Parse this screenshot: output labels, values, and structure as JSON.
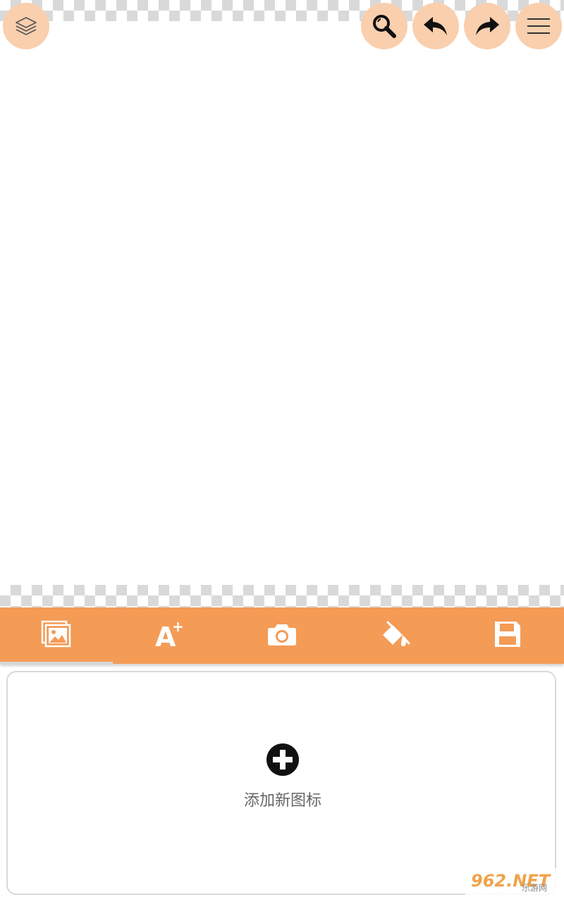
{
  "app": {
    "accent_color": "#f49b56",
    "fab_color": "#f9cfae"
  },
  "top_actions": [
    {
      "name": "layers",
      "icon": "layers-icon"
    },
    {
      "name": "zoom",
      "icon": "magnifier-icon"
    },
    {
      "name": "undo",
      "icon": "undo-arrow-icon"
    },
    {
      "name": "redo",
      "icon": "redo-arrow-icon"
    },
    {
      "name": "menu",
      "icon": "hamburger-menu-icon"
    }
  ],
  "toolbar": {
    "tabs": [
      {
        "name": "images",
        "icon": "image-gallery-icon",
        "active": true
      },
      {
        "name": "add-text",
        "icon": "text-add-icon",
        "label": "A+"
      },
      {
        "name": "camera",
        "icon": "camera-icon"
      },
      {
        "name": "fill-color",
        "icon": "paint-bucket-icon"
      },
      {
        "name": "save",
        "icon": "save-floppy-icon"
      }
    ]
  },
  "panel": {
    "add_icon_label": "添加新图标",
    "add_icon_icon": "plus-circle-icon"
  },
  "watermark": {
    "main": "962.NET",
    "sub": "乐游网"
  }
}
